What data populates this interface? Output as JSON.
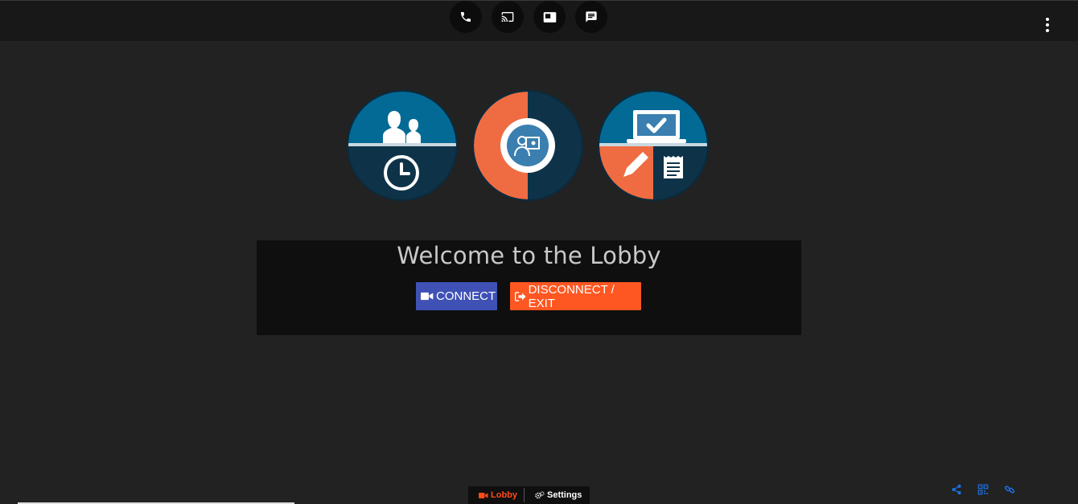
{
  "topbar": {
    "buttons": [
      {
        "name": "phone-icon"
      },
      {
        "name": "cast-icon"
      },
      {
        "name": "layout-icon"
      },
      {
        "name": "chat-icon"
      }
    ],
    "menu_icon": "more-vert-icon"
  },
  "feature_icons": [
    "group-schedule-icon",
    "presenter-icon",
    "laptop-tasks-icon"
  ],
  "main": {
    "title": "Welcome to the Lobby",
    "connect_label": "CONNECT",
    "disconnect_label": "DISCONNECT / EXIT"
  },
  "bottom_tabs": {
    "lobby_label": "Lobby",
    "settings_label": "Settings"
  },
  "bottom_right_icons": [
    "share-icon",
    "qr-code-icon",
    "link-icon"
  ],
  "colors": {
    "accent_blue": "#3f51b5",
    "accent_orange": "#ff5722",
    "circle_blue": "#036a96",
    "circle_navy": "#0e3349",
    "circle_orange": "#ef6c42",
    "link_blue": "#1a73e8"
  }
}
